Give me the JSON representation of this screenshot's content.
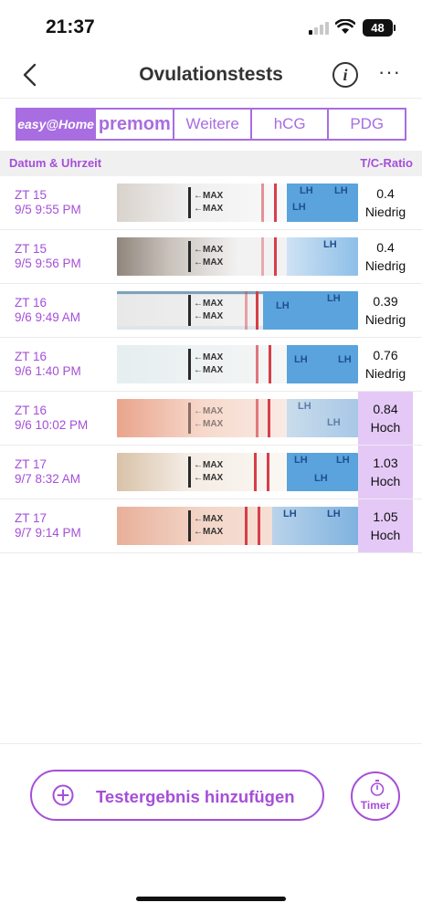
{
  "status_bar": {
    "time": "21:37",
    "battery": "48"
  },
  "nav": {
    "title": "Ovulationstests",
    "back_icon": "chevron-left-icon",
    "info_icon": "info-icon",
    "more_icon": "more-icon"
  },
  "brand_tabs": [
    {
      "label": "easy@Home",
      "active": true
    },
    {
      "label": "premom",
      "active": false
    },
    {
      "label": "Weitere",
      "active": false
    },
    {
      "label": "hCG",
      "active": false
    },
    {
      "label": "PDG",
      "active": false
    }
  ],
  "table_header": {
    "left": "Datum & Uhrzeit",
    "right": "T/C-Ratio"
  },
  "strip_text": {
    "max": "←MAX",
    "lh": "LH"
  },
  "rows": [
    {
      "day": "ZT 15",
      "datetime": "9/5 9:55 PM",
      "ratio": "0.4",
      "level": "Niedrig",
      "high": false
    },
    {
      "day": "ZT 15",
      "datetime": "9/5 9:56 PM",
      "ratio": "0.4",
      "level": "Niedrig",
      "high": false
    },
    {
      "day": "ZT 16",
      "datetime": "9/6 9:49 AM",
      "ratio": "0.39",
      "level": "Niedrig",
      "high": false
    },
    {
      "day": "ZT 16",
      "datetime": "9/6 1:40 PM",
      "ratio": "0.76",
      "level": "Niedrig",
      "high": false
    },
    {
      "day": "ZT 16",
      "datetime": "9/6 10:02 PM",
      "ratio": "0.84",
      "level": "Hoch",
      "high": true
    },
    {
      "day": "ZT 17",
      "datetime": "9/7 8:32 AM",
      "ratio": "1.03",
      "level": "Hoch",
      "high": true
    },
    {
      "day": "ZT 17",
      "datetime": "9/7 9:14 PM",
      "ratio": "1.05",
      "level": "Hoch",
      "high": true
    }
  ],
  "add_button": {
    "label": "Testergebnis hinzufügen",
    "icon": "plus-circle-icon"
  },
  "timer_button": {
    "label": "Timer",
    "icon": "stopwatch-icon"
  },
  "colors": {
    "accent": "#a54fd8",
    "high_bg": "#e4c9f7",
    "control_line": "#d63e4a"
  }
}
